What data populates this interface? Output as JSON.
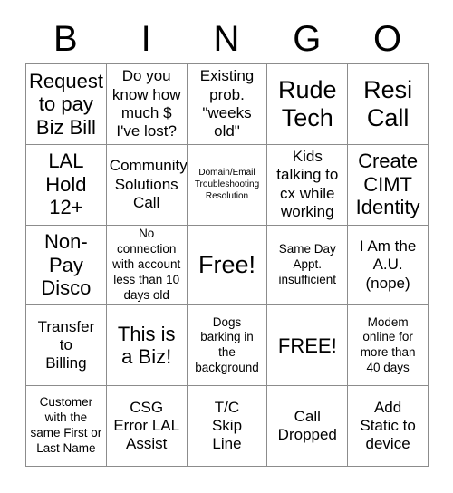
{
  "card": {
    "title": "BINGO",
    "header_letters": [
      "B",
      "I",
      "N",
      "G",
      "O"
    ],
    "columns": 5,
    "rows": 5,
    "border_color": "#8c8c8c",
    "text_color": "#000000",
    "background_color": "#ffffff",
    "cells": [
      {
        "text": "Request\nto pay\nBiz Bill",
        "size": "lg",
        "free": false
      },
      {
        "text": "Do you\nknow how\nmuch $\nI've lost?",
        "size": "md",
        "free": false
      },
      {
        "text": "Existing\nprob.\n\"weeks\nold\"",
        "size": "md",
        "free": false
      },
      {
        "text": "Rude\nTech",
        "size": "xl",
        "free": false
      },
      {
        "text": "Resi\nCall",
        "size": "xl",
        "free": false
      },
      {
        "text": "LAL\nHold\n12+",
        "size": "lg",
        "free": false
      },
      {
        "text": "Community\nSolutions\nCall",
        "size": "md",
        "free": false
      },
      {
        "text": "Domain/Email\nTroubleshooting\nResolution",
        "size": "xs",
        "free": false
      },
      {
        "text": "Kids\ntalking to\ncx while\nworking",
        "size": "md",
        "free": false
      },
      {
        "text": "Create\nCIMT\nIdentity",
        "size": "lg",
        "free": false
      },
      {
        "text": "Non-\nPay\nDisco",
        "size": "lg",
        "free": false
      },
      {
        "text": "No\nconnection\nwith account\nless than 10\ndays old",
        "size": "sm",
        "free": false
      },
      {
        "text": "Free!",
        "size": "xl",
        "free": true
      },
      {
        "text": "Same Day\nAppt.\ninsufficient",
        "size": "sm",
        "free": false
      },
      {
        "text": "I Am the\nA.U.\n(nope)",
        "size": "md",
        "free": false
      },
      {
        "text": "Transfer\nto\nBilling",
        "size": "md",
        "free": false
      },
      {
        "text": "This is\na Biz!",
        "size": "lg",
        "free": false
      },
      {
        "text": "Dogs\nbarking in\nthe\nbackground",
        "size": "sm",
        "free": false
      },
      {
        "text": "FREE!",
        "size": "lg",
        "free": true
      },
      {
        "text": "Modem\nonline for\nmore than\n40 days",
        "size": "sm",
        "free": false
      },
      {
        "text": "Customer\nwith the\nsame First or\nLast Name",
        "size": "sm",
        "free": false
      },
      {
        "text": "CSG\nError LAL\nAssist",
        "size": "md",
        "free": false
      },
      {
        "text": "T/C\nSkip\nLine",
        "size": "md",
        "free": false
      },
      {
        "text": "Call\nDropped",
        "size": "md",
        "free": false
      },
      {
        "text": "Add\nStatic to\ndevice",
        "size": "md",
        "free": false
      }
    ]
  }
}
